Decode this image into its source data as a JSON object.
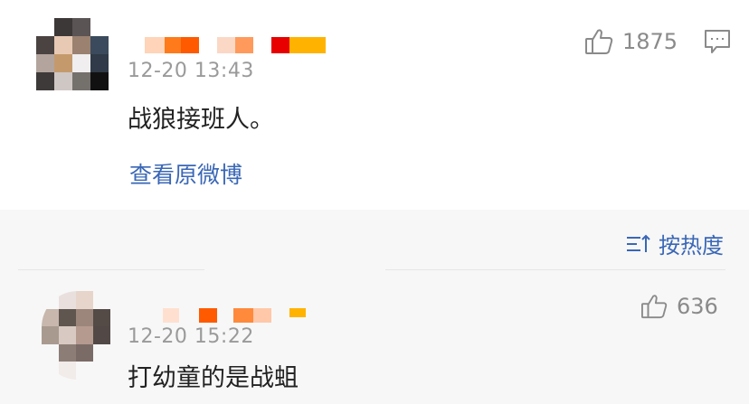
{
  "comments": [
    {
      "time": "12-20 13:43",
      "text": "战狼接班人。",
      "likes": "1875",
      "view_original": "查看原微博",
      "avatar_icon": "blurred-avatar",
      "reply_icon": "comment-icon",
      "like_icon": "thumbs-up-icon"
    },
    {
      "time": "12-20 15:22",
      "text": "打幼童的是战蛆",
      "likes": "636",
      "avatar_icon": "blurred-avatar",
      "like_icon": "thumbs-up-icon"
    }
  ],
  "sort": {
    "label": "按热度",
    "icon": "sort-icon"
  },
  "colors": {
    "link": "#3a67b6",
    "text": "#222222",
    "meta": "#9a9a9a",
    "background_secondary": "#f7f7f7"
  }
}
